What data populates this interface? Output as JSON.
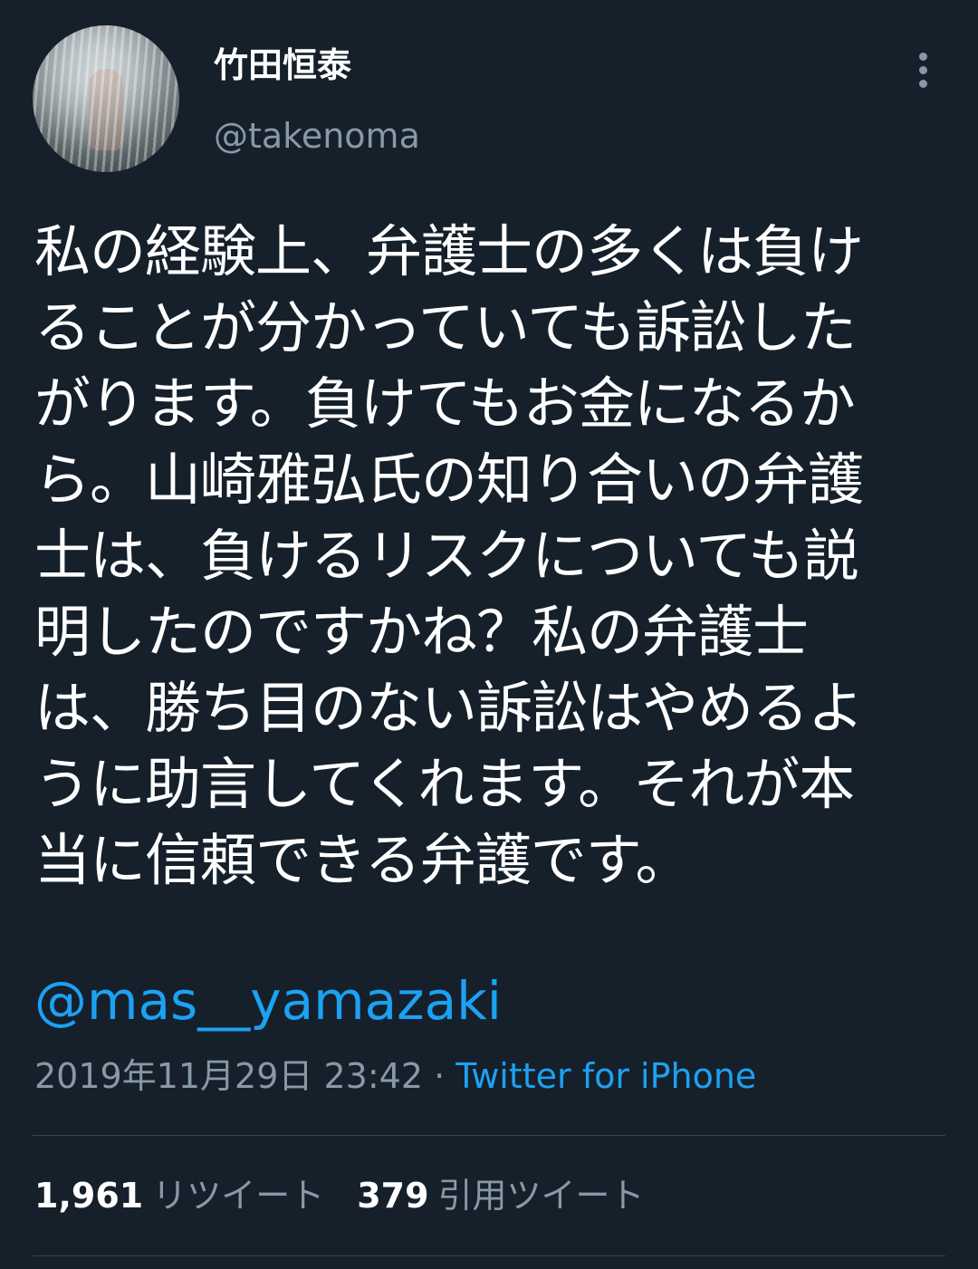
{
  "user": {
    "display_name": "竹田恒泰",
    "handle": "@takenoma"
  },
  "tweet": {
    "lines": [
      "私の経験上、弁護士の多くは負け",
      "ることが分かっていても訴訟した",
      "がります。負けてもお金になるか",
      "ら。山崎雅弘氏の知り合いの弁護",
      "士は、負けるリスクについても説",
      "明したのですかね？私の弁護士",
      "は、勝ち目のない訴訟はやめるよ",
      "うに助言してくれます。それが本",
      "当に信頼できる弁護です。"
    ],
    "mention": "@mas__yamazaki",
    "timestamp": "2019年11月29日 23:42",
    "separator": " · ",
    "source": "Twitter for iPhone"
  },
  "stats": {
    "retweets_count": "1,961",
    "retweets_label": "リツイート",
    "quotes_count": "379",
    "quotes_label": "引用ツイート"
  },
  "icons": {
    "more": "more-vertical-icon"
  },
  "colors": {
    "background": "#15202b",
    "accent": "#1da1f2",
    "secondary_text": "#8899a6",
    "divider": "#38444d"
  }
}
